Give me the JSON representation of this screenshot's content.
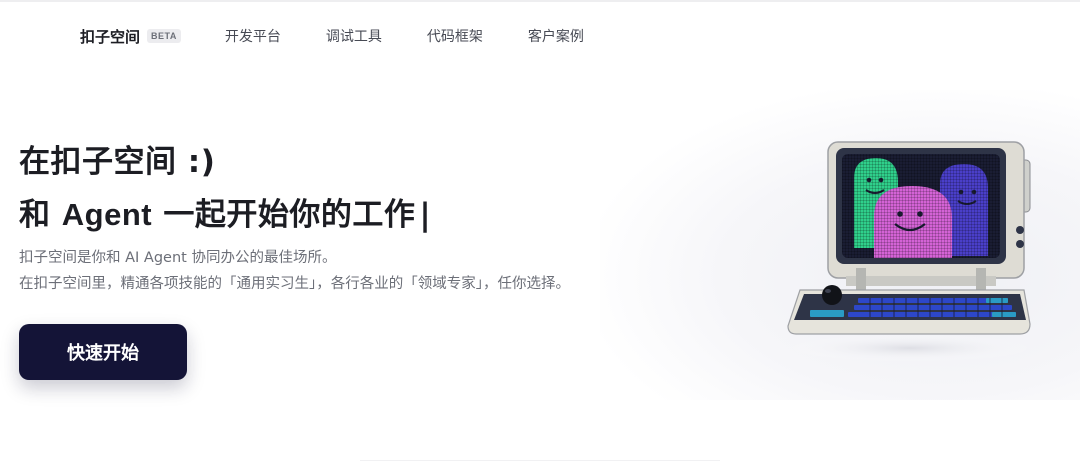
{
  "nav": {
    "brand": "扣子空间",
    "badge": "BETA",
    "items": [
      {
        "label": "开发平台"
      },
      {
        "label": "调试工具"
      },
      {
        "label": "代码框架"
      },
      {
        "label": "客户案例"
      }
    ]
  },
  "hero": {
    "title_line1": "在扣子空间 :)",
    "title_line2_prefix": "和 ",
    "title_line2_agent": "Agent",
    "title_line2_suffix": " 一起开始你的工作",
    "cursor": "|",
    "desc_line1": "扣子空间是你和 AI Agent 协同办公的最佳场所。",
    "desc_line2": "在扣子空间里，精通各项技能的「通用实习生」，各行各业的「领域专家」，任你选择。",
    "cta_label": "快速开始"
  },
  "illustration": {
    "icon": "retro-computer-illustration",
    "colors": {
      "screen_green": "#2fcf8b",
      "screen_pink": "#d463d6",
      "screen_purple": "#4a3fc9",
      "keys_blue": "#2d47c8",
      "keys_teal": "#2a9bc4",
      "body": "#e6e4dc",
      "frame": "#2e3447"
    }
  },
  "theme": {
    "cta_bg": "#141437",
    "text_dark": "#1c1d23",
    "text_muted": "#6c6f78"
  }
}
